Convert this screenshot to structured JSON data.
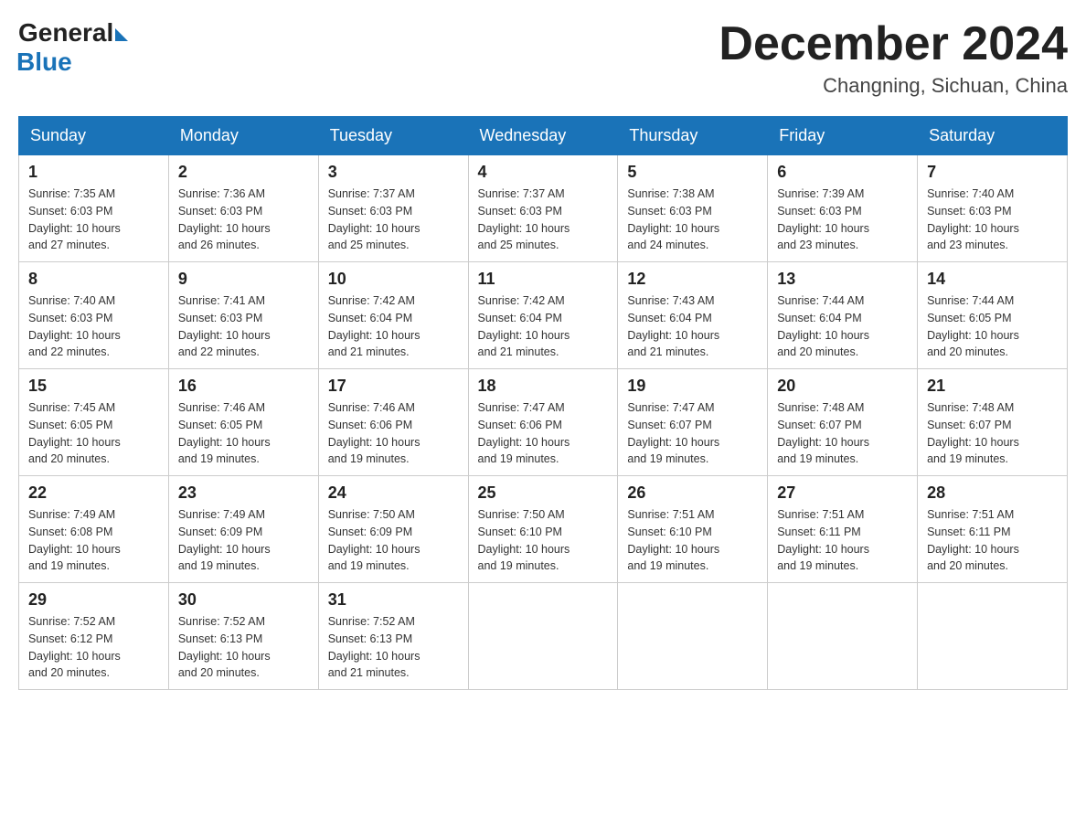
{
  "header": {
    "logo": {
      "general": "General",
      "blue": "Blue",
      "arrow": "▶"
    },
    "title": "December 2024",
    "location": "Changning, Sichuan, China"
  },
  "days_of_week": [
    "Sunday",
    "Monday",
    "Tuesday",
    "Wednesday",
    "Thursday",
    "Friday",
    "Saturday"
  ],
  "weeks": [
    [
      {
        "day": "1",
        "sunrise": "7:35 AM",
        "sunset": "6:03 PM",
        "daylight": "10 hours and 27 minutes."
      },
      {
        "day": "2",
        "sunrise": "7:36 AM",
        "sunset": "6:03 PM",
        "daylight": "10 hours and 26 minutes."
      },
      {
        "day": "3",
        "sunrise": "7:37 AM",
        "sunset": "6:03 PM",
        "daylight": "10 hours and 25 minutes."
      },
      {
        "day": "4",
        "sunrise": "7:37 AM",
        "sunset": "6:03 PM",
        "daylight": "10 hours and 25 minutes."
      },
      {
        "day": "5",
        "sunrise": "7:38 AM",
        "sunset": "6:03 PM",
        "daylight": "10 hours and 24 minutes."
      },
      {
        "day": "6",
        "sunrise": "7:39 AM",
        "sunset": "6:03 PM",
        "daylight": "10 hours and 23 minutes."
      },
      {
        "day": "7",
        "sunrise": "7:40 AM",
        "sunset": "6:03 PM",
        "daylight": "10 hours and 23 minutes."
      }
    ],
    [
      {
        "day": "8",
        "sunrise": "7:40 AM",
        "sunset": "6:03 PM",
        "daylight": "10 hours and 22 minutes."
      },
      {
        "day": "9",
        "sunrise": "7:41 AM",
        "sunset": "6:03 PM",
        "daylight": "10 hours and 22 minutes."
      },
      {
        "day": "10",
        "sunrise": "7:42 AM",
        "sunset": "6:04 PM",
        "daylight": "10 hours and 21 minutes."
      },
      {
        "day": "11",
        "sunrise": "7:42 AM",
        "sunset": "6:04 PM",
        "daylight": "10 hours and 21 minutes."
      },
      {
        "day": "12",
        "sunrise": "7:43 AM",
        "sunset": "6:04 PM",
        "daylight": "10 hours and 21 minutes."
      },
      {
        "day": "13",
        "sunrise": "7:44 AM",
        "sunset": "6:04 PM",
        "daylight": "10 hours and 20 minutes."
      },
      {
        "day": "14",
        "sunrise": "7:44 AM",
        "sunset": "6:05 PM",
        "daylight": "10 hours and 20 minutes."
      }
    ],
    [
      {
        "day": "15",
        "sunrise": "7:45 AM",
        "sunset": "6:05 PM",
        "daylight": "10 hours and 20 minutes."
      },
      {
        "day": "16",
        "sunrise": "7:46 AM",
        "sunset": "6:05 PM",
        "daylight": "10 hours and 19 minutes."
      },
      {
        "day": "17",
        "sunrise": "7:46 AM",
        "sunset": "6:06 PM",
        "daylight": "10 hours and 19 minutes."
      },
      {
        "day": "18",
        "sunrise": "7:47 AM",
        "sunset": "6:06 PM",
        "daylight": "10 hours and 19 minutes."
      },
      {
        "day": "19",
        "sunrise": "7:47 AM",
        "sunset": "6:07 PM",
        "daylight": "10 hours and 19 minutes."
      },
      {
        "day": "20",
        "sunrise": "7:48 AM",
        "sunset": "6:07 PM",
        "daylight": "10 hours and 19 minutes."
      },
      {
        "day": "21",
        "sunrise": "7:48 AM",
        "sunset": "6:07 PM",
        "daylight": "10 hours and 19 minutes."
      }
    ],
    [
      {
        "day": "22",
        "sunrise": "7:49 AM",
        "sunset": "6:08 PM",
        "daylight": "10 hours and 19 minutes."
      },
      {
        "day": "23",
        "sunrise": "7:49 AM",
        "sunset": "6:09 PM",
        "daylight": "10 hours and 19 minutes."
      },
      {
        "day": "24",
        "sunrise": "7:50 AM",
        "sunset": "6:09 PM",
        "daylight": "10 hours and 19 minutes."
      },
      {
        "day": "25",
        "sunrise": "7:50 AM",
        "sunset": "6:10 PM",
        "daylight": "10 hours and 19 minutes."
      },
      {
        "day": "26",
        "sunrise": "7:51 AM",
        "sunset": "6:10 PM",
        "daylight": "10 hours and 19 minutes."
      },
      {
        "day": "27",
        "sunrise": "7:51 AM",
        "sunset": "6:11 PM",
        "daylight": "10 hours and 19 minutes."
      },
      {
        "day": "28",
        "sunrise": "7:51 AM",
        "sunset": "6:11 PM",
        "daylight": "10 hours and 20 minutes."
      }
    ],
    [
      {
        "day": "29",
        "sunrise": "7:52 AM",
        "sunset": "6:12 PM",
        "daylight": "10 hours and 20 minutes."
      },
      {
        "day": "30",
        "sunrise": "7:52 AM",
        "sunset": "6:13 PM",
        "daylight": "10 hours and 20 minutes."
      },
      {
        "day": "31",
        "sunrise": "7:52 AM",
        "sunset": "6:13 PM",
        "daylight": "10 hours and 21 minutes."
      },
      null,
      null,
      null,
      null
    ]
  ],
  "labels": {
    "sunrise": "Sunrise:",
    "sunset": "Sunset:",
    "daylight": "Daylight:"
  }
}
